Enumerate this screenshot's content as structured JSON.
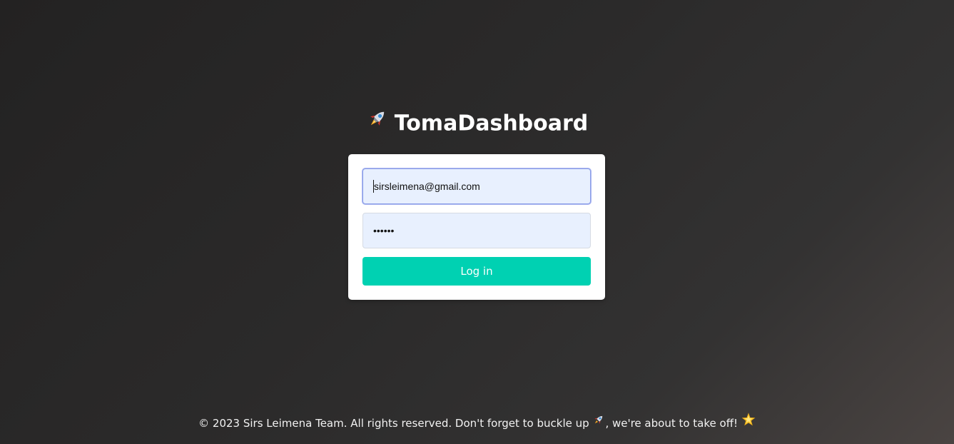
{
  "app": {
    "title": "TomaDashboard",
    "logo_icon": "rocket-icon"
  },
  "login_form": {
    "email_value": "sirsleimena@gmail.com",
    "password_value": "••••••",
    "login_label": "Log in"
  },
  "footer": {
    "text_main": "© 2023 Sirs Leimena Team. All rights reserved. Don't forget to buckle up",
    "text_tail": ", we're about to take off!",
    "icons": [
      "rocket-icon",
      "star-icon"
    ]
  },
  "colors": {
    "accent": "#00d1b2",
    "input_background": "#e8f0fe",
    "card_background": "#ffffff"
  }
}
